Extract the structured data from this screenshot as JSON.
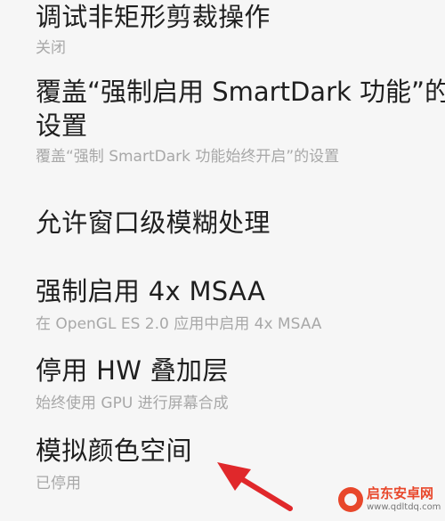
{
  "settings": {
    "items": [
      {
        "title": "调试非矩形剪裁操作",
        "summary": "关闭"
      },
      {
        "title": "覆盖“强制启用 SmartDark 功能”的设置",
        "summary": "覆盖“强制 SmartDark 功能始终开启”的设置"
      },
      {
        "title": "允许窗口级模糊处理"
      },
      {
        "title": "强制启用 4x MSAA",
        "summary": "在 OpenGL ES 2.0 应用中启用 4x MSAA"
      },
      {
        "title": "停用 HW 叠加层",
        "summary": "始终使用 GPU 进行屏幕合成"
      },
      {
        "title": "模拟颜色空间",
        "summary": "已停用"
      }
    ]
  },
  "annotation": {
    "arrow_color": "#e0282b"
  },
  "watermark": {
    "name": "启东安卓网",
    "url": "www.qdltdq.com",
    "color": "#e8472b"
  }
}
